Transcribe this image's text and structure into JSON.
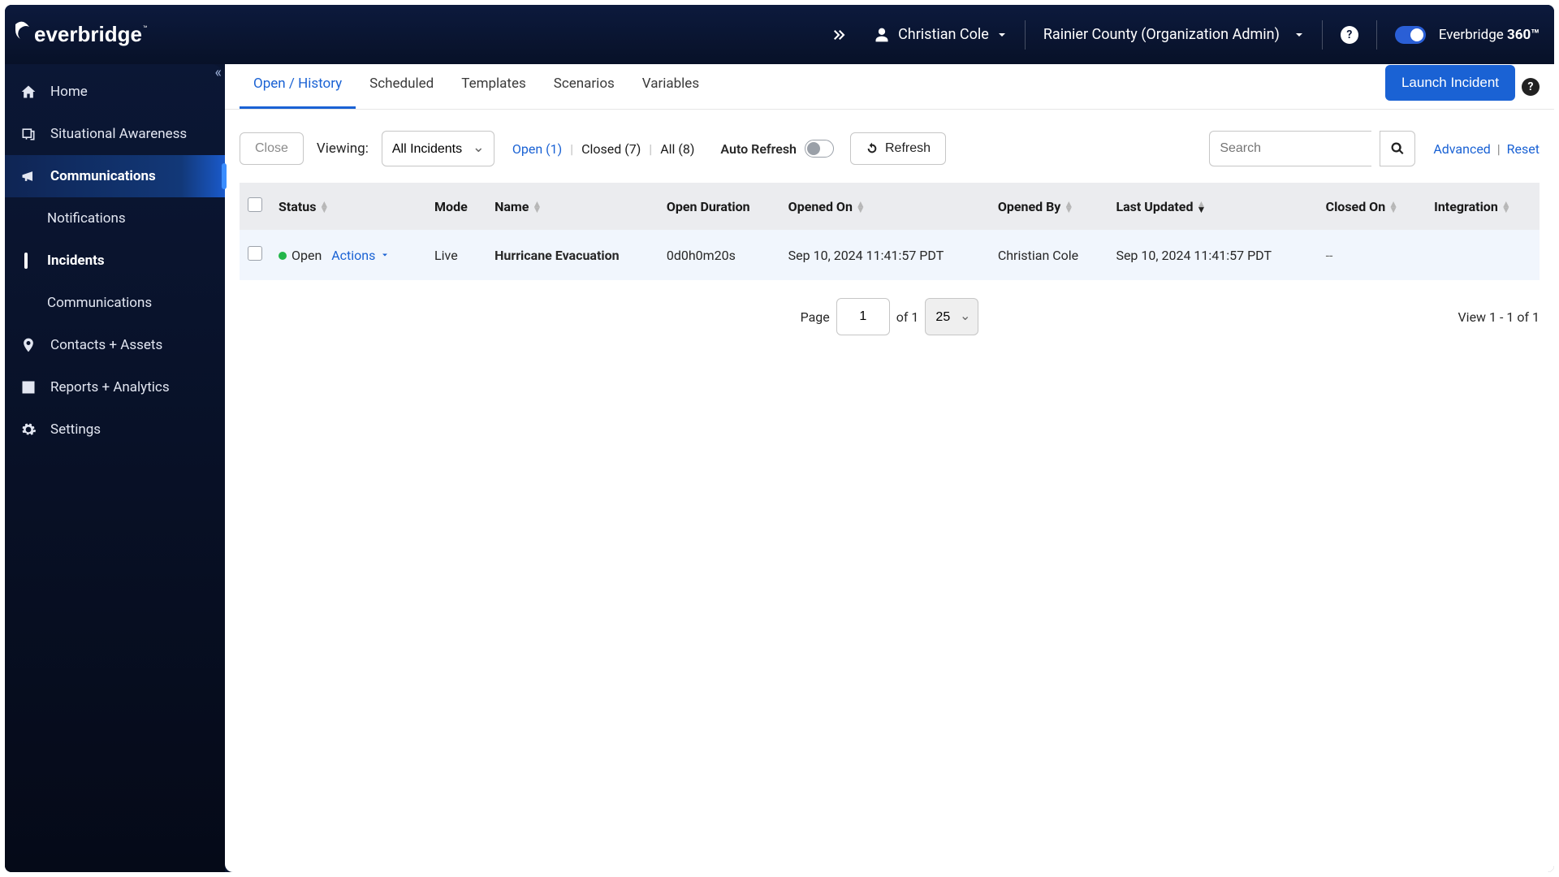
{
  "header": {
    "user": "Christian Cole",
    "org": "Rainier County (Organization Admin)",
    "brand_prefix": "Everbridge ",
    "brand_suffix": "360™"
  },
  "sidebar": {
    "items": [
      {
        "label": "Home"
      },
      {
        "label": "Situational Awareness"
      },
      {
        "label": "Communications"
      },
      {
        "label": "Contacts + Assets"
      },
      {
        "label": "Reports + Analytics"
      },
      {
        "label": "Settings"
      }
    ],
    "comm_children": [
      {
        "label": "Notifications"
      },
      {
        "label": "Incidents"
      },
      {
        "label": "Communications"
      }
    ]
  },
  "tabs": {
    "items": [
      {
        "label": "Open / History"
      },
      {
        "label": "Scheduled"
      },
      {
        "label": "Templates"
      },
      {
        "label": "Scenarios"
      },
      {
        "label": "Variables"
      }
    ],
    "launch": "Launch Incident"
  },
  "toolbar": {
    "close": "Close",
    "viewing_label": "Viewing:",
    "viewing_value": "All Incidents",
    "open_filter": "Open (1)",
    "closed_filter": "Closed (7)",
    "all_filter": "All (8)",
    "auto_refresh": "Auto Refresh",
    "refresh": "Refresh",
    "search_placeholder": "Search",
    "advanced": "Advanced",
    "reset": "Reset"
  },
  "table": {
    "cols": [
      "Status",
      "Mode",
      "Name",
      "Open Duration",
      "Opened On",
      "Opened By",
      "Last Updated",
      "Closed On",
      "Integration"
    ],
    "row": {
      "status": "Open",
      "actions": "Actions",
      "mode": "Live",
      "name": "Hurricane Evacuation",
      "open_duration": "0d0h0m20s",
      "opened_on": "Sep 10, 2024 11:41:57 PDT",
      "opened_by": "Christian Cole",
      "last_updated": "Sep 10, 2024 11:41:57 PDT",
      "closed_on": "--",
      "integration": ""
    }
  },
  "pagination": {
    "page_label": "Page",
    "page_value": "1",
    "of_label": "of 1",
    "pagesize": "25",
    "view": "View 1 - 1 of 1"
  }
}
